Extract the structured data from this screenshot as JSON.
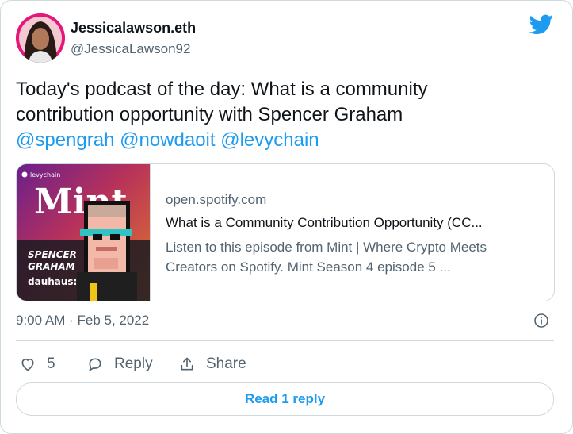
{
  "author": {
    "display_name": "Jessicalawson.eth",
    "handle": "@JessicaLawson92"
  },
  "tweet": {
    "text_line1": "Today's podcast of the day: What is a community",
    "text_line2": "contribution opportunity with Spencer Graham",
    "mentions": [
      "@spengrah",
      "@nowdaoit",
      "@levychain"
    ]
  },
  "link_card": {
    "domain": "open.spotify.com",
    "title": "What is a Community Contribution Opportunity (CC...",
    "description_line1": "Listen to this episode from Mint | Where Crypto Meets",
    "description_line2": "Creators on Spotify. Mint Season 4 episode 5 ...",
    "thumbnail": {
      "channel": "levychain",
      "logo_text": "Mint",
      "guest_line1": "SPENCER",
      "guest_line2": "GRAHAM",
      "brand": "dauhaus:"
    }
  },
  "timestamp": "9:00 AM · Feb 5, 2022",
  "actions": {
    "like_count": "5",
    "reply_label": "Reply",
    "share_label": "Share"
  },
  "read_replies_label": "Read 1 reply",
  "colors": {
    "link_blue": "#1d9bf0",
    "secondary_text": "#536471",
    "border": "#cfd9de",
    "avatar_ring": "#e5177b"
  },
  "icons": [
    "twitter-bird-icon",
    "info-icon",
    "heart-icon",
    "reply-icon",
    "share-icon"
  ]
}
